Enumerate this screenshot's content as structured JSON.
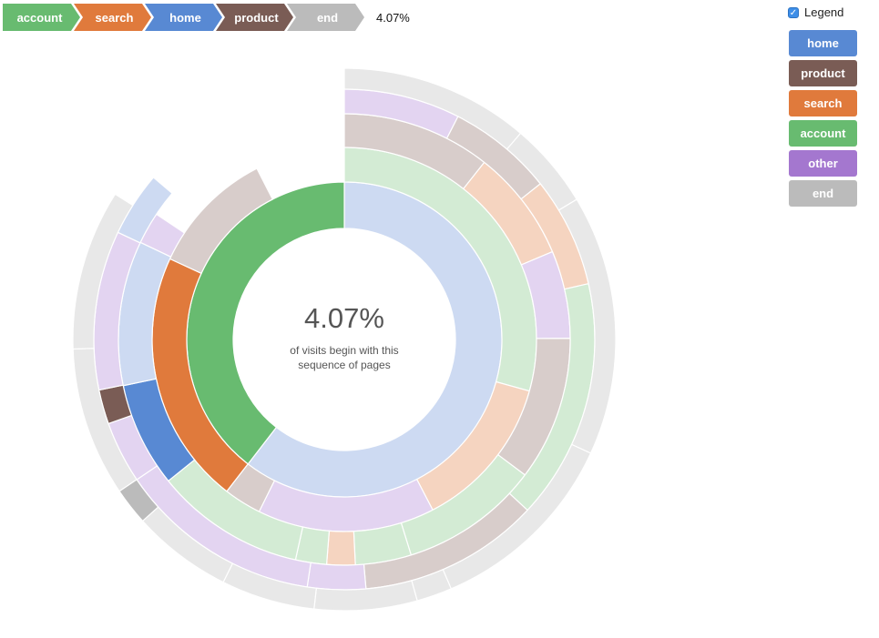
{
  "breadcrumb": {
    "steps": [
      {
        "label": "account",
        "color": "#68bb70"
      },
      {
        "label": "search",
        "color": "#e07a3c"
      },
      {
        "label": "home",
        "color": "#5889d3"
      },
      {
        "label": "product",
        "color": "#7a5c55"
      },
      {
        "label": "end",
        "color": "#bbbbbb"
      }
    ],
    "percentage": "4.07%"
  },
  "legend": {
    "toggle_label": "Legend",
    "checked": true,
    "items": [
      {
        "label": "home",
        "color": "#5889d3"
      },
      {
        "label": "product",
        "color": "#7a5c55"
      },
      {
        "label": "search",
        "color": "#e07a3c"
      },
      {
        "label": "account",
        "color": "#68bb70"
      },
      {
        "label": "other",
        "color": "#a477cf"
      },
      {
        "label": "end",
        "color": "#bbbbbb"
      }
    ]
  },
  "center": {
    "percentage": "4.07%",
    "caption": "of visits begin with this sequence of pages"
  },
  "chart_data": {
    "type": "sunburst",
    "highlighted_path": [
      "account",
      "search",
      "home",
      "product",
      "end"
    ],
    "highlighted_share": "4.07%",
    "ring_note": "segments listed clockwise from top, as fractions of a full circle",
    "rings": [
      [
        {
          "category": "home",
          "frac": 0.6047
        },
        {
          "category": "account",
          "frac": 0.3953,
          "highlighted": true
        }
      ],
      [
        {
          "category": "account",
          "frac": 0.2933
        },
        {
          "category": "search",
          "frac": 0.1306
        },
        {
          "category": "other",
          "frac": 0.1492
        },
        {
          "category": "product",
          "frac": 0.0317
        },
        {
          "category": "search",
          "frac": 0.2142,
          "highlighted": true
        },
        {
          "category": "product",
          "frac": 0.1058
        }
      ],
      [
        {
          "category": "product",
          "frac": 0.1064
        },
        {
          "category": "search",
          "frac": 0.08
        },
        {
          "category": "other",
          "frac": 0.0628
        },
        {
          "category": "product",
          "frac": 0.1033
        },
        {
          "category": "account",
          "frac": 0.0997
        },
        {
          "category": "account",
          "frac": 0.04
        },
        {
          "category": "search",
          "frac": 0.0203
        },
        {
          "category": "account",
          "frac": 0.0222
        },
        {
          "category": "account",
          "frac": 0.1075
        },
        {
          "category": "home",
          "frac": 0.075,
          "highlighted": true
        },
        {
          "category": "home",
          "frac": 0.1036
        },
        {
          "category": "other",
          "frac": 0.0228
        }
      ],
      [
        {
          "category": "other",
          "frac": 0.075
        },
        {
          "category": "product",
          "frac": 0.0681
        },
        {
          "category": "search",
          "frac": 0.0711
        },
        {
          "category": "account",
          "frac": 0.1553
        },
        {
          "category": "product",
          "frac": 0.1167
        },
        {
          "category": "other",
          "frac": 0.0375
        },
        {
          "category": "other",
          "frac": 0.1317
        },
        {
          "category": "other",
          "frac": 0.04
        },
        {
          "category": "product",
          "frac": 0.0222,
          "highlighted": true
        },
        {
          "category": "other",
          "frac": 0.1028
        },
        {
          "category": "home",
          "frac": 0.0417
        }
      ],
      [
        {
          "category": "end",
          "frac": 0.1125
        },
        {
          "category": "end",
          "frac": 0.0511
        },
        {
          "category": "end",
          "frac": 0.1553
        },
        {
          "category": "end",
          "frac": 0.1167
        },
        {
          "category": "end",
          "frac": 0.0211
        },
        {
          "category": "end",
          "frac": 0.0611
        },
        {
          "category": "end",
          "frac": 0.0558
        },
        {
          "category": "end",
          "frac": 0.0597
        },
        {
          "category": "end",
          "frac": 0.0222,
          "highlighted": true
        },
        {
          "category": "end",
          "frac": 0.0889
        },
        {
          "category": "end",
          "frac": 0.0956
        }
      ]
    ]
  }
}
